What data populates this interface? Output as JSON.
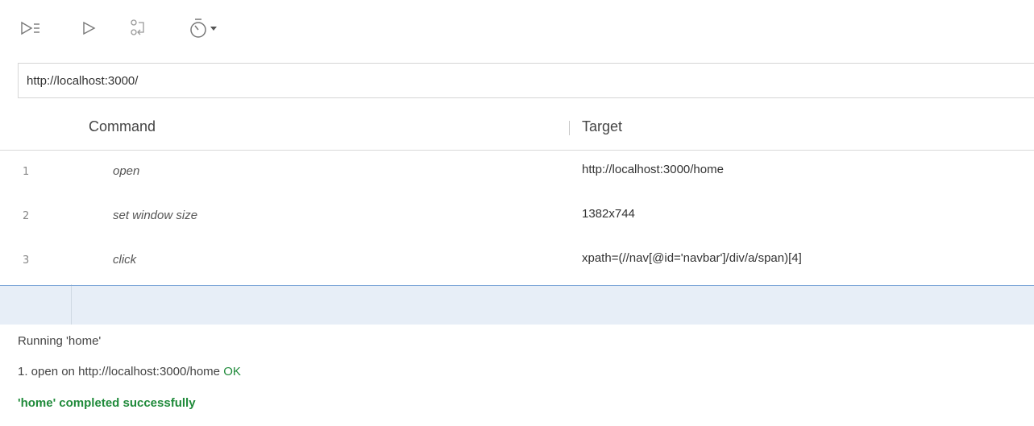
{
  "toolbar": {
    "buttons": [
      {
        "name": "run-all-tests",
        "icon": "run-all-icon"
      },
      {
        "name": "run-current-test",
        "icon": "play-icon"
      },
      {
        "name": "step-over",
        "icon": "step-icon"
      },
      {
        "name": "test-speed",
        "icon": "stopwatch-icon",
        "has_dropdown": true
      }
    ]
  },
  "url": {
    "value": "http://localhost:3000/"
  },
  "grid": {
    "headers": {
      "command": "Command",
      "target": "Target"
    },
    "rows": [
      {
        "num": "1",
        "command": "open",
        "target": "http://localhost:3000/home"
      },
      {
        "num": "2",
        "command": "set window size",
        "target": "1382x744"
      },
      {
        "num": "3",
        "command": "click",
        "target": "xpath=(//nav[@id='navbar']/div/a/span)[4]"
      }
    ]
  },
  "log": {
    "running": "Running 'home'",
    "step1_prefix": "1.  open on http://localhost:3000/home ",
    "step1_status": "OK",
    "completed": "'home' completed successfully"
  },
  "colors": {
    "accent": "#7ea7d8",
    "selected_row_bg": "#e7eef7",
    "success": "#1f8a3a"
  }
}
